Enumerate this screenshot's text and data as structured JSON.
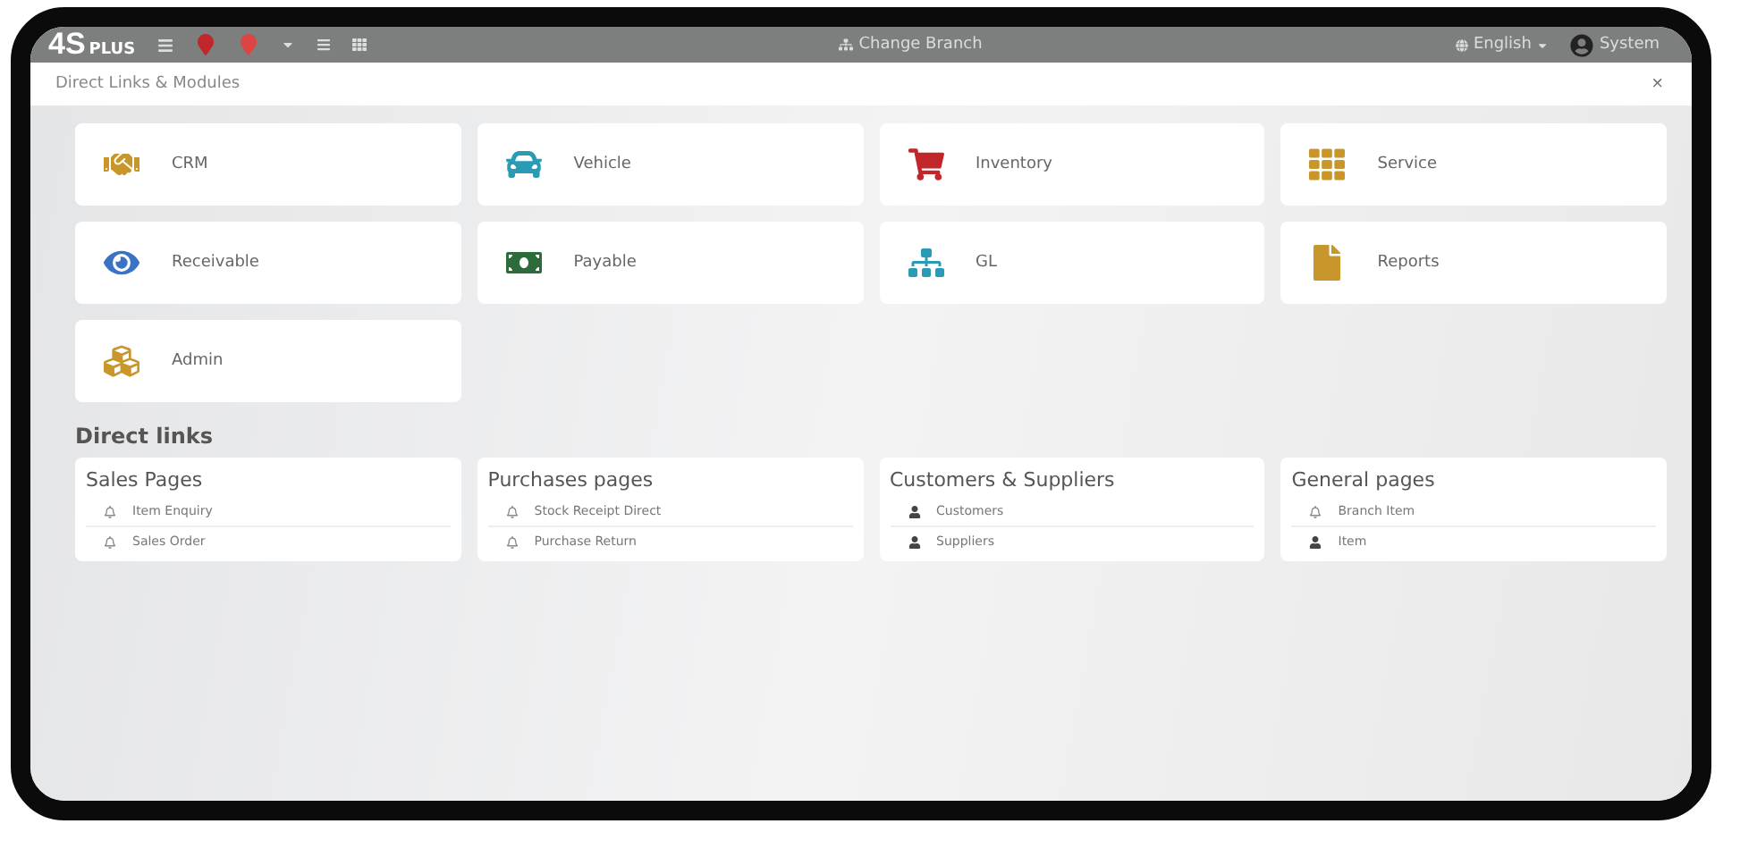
{
  "topbar": {
    "logo": "4S",
    "logo_suffix": "PLUS",
    "change_branch": "Change Branch",
    "language": "English",
    "user": "System"
  },
  "dialog": {
    "title": "Direct Links & Modules",
    "close": "×"
  },
  "modules": [
    {
      "label": "CRM",
      "kind": "handshake",
      "color": "#c9962b"
    },
    {
      "label": "Vehicle",
      "kind": "car",
      "color": "#2a9bb5"
    },
    {
      "label": "Inventory",
      "kind": "cart",
      "color": "#c0262a"
    },
    {
      "label": "Service",
      "kind": "grid",
      "color": "#c9962b"
    },
    {
      "label": "Receivable",
      "kind": "eye",
      "color": "#3a73c4"
    },
    {
      "label": "Payable",
      "kind": "money",
      "color": "#2e6b3a"
    },
    {
      "label": "GL",
      "kind": "sitemap",
      "color": "#2a9bb5"
    },
    {
      "label": "Reports",
      "kind": "file",
      "color": "#c9962b"
    },
    {
      "label": "Admin",
      "kind": "cubes",
      "color": "#c9962b"
    }
  ],
  "direct_links": {
    "heading": "Direct links",
    "groups": [
      {
        "title": "Sales Pages",
        "links": [
          {
            "label": "Item Enquiry",
            "kind": "bell"
          },
          {
            "label": "Sales Order",
            "kind": "bell"
          }
        ]
      },
      {
        "title": "Purchases pages",
        "links": [
          {
            "label": "Stock Receipt Direct",
            "kind": "bell"
          },
          {
            "label": "Purchase Return",
            "kind": "bell"
          }
        ]
      },
      {
        "title": "Customers & Suppliers",
        "links": [
          {
            "label": "Customers",
            "kind": "user"
          },
          {
            "label": "Suppliers",
            "kind": "user"
          }
        ]
      },
      {
        "title": "General pages",
        "links": [
          {
            "label": "Branch Item",
            "kind": "bell"
          },
          {
            "label": "Item",
            "kind": "user"
          }
        ]
      }
    ]
  }
}
